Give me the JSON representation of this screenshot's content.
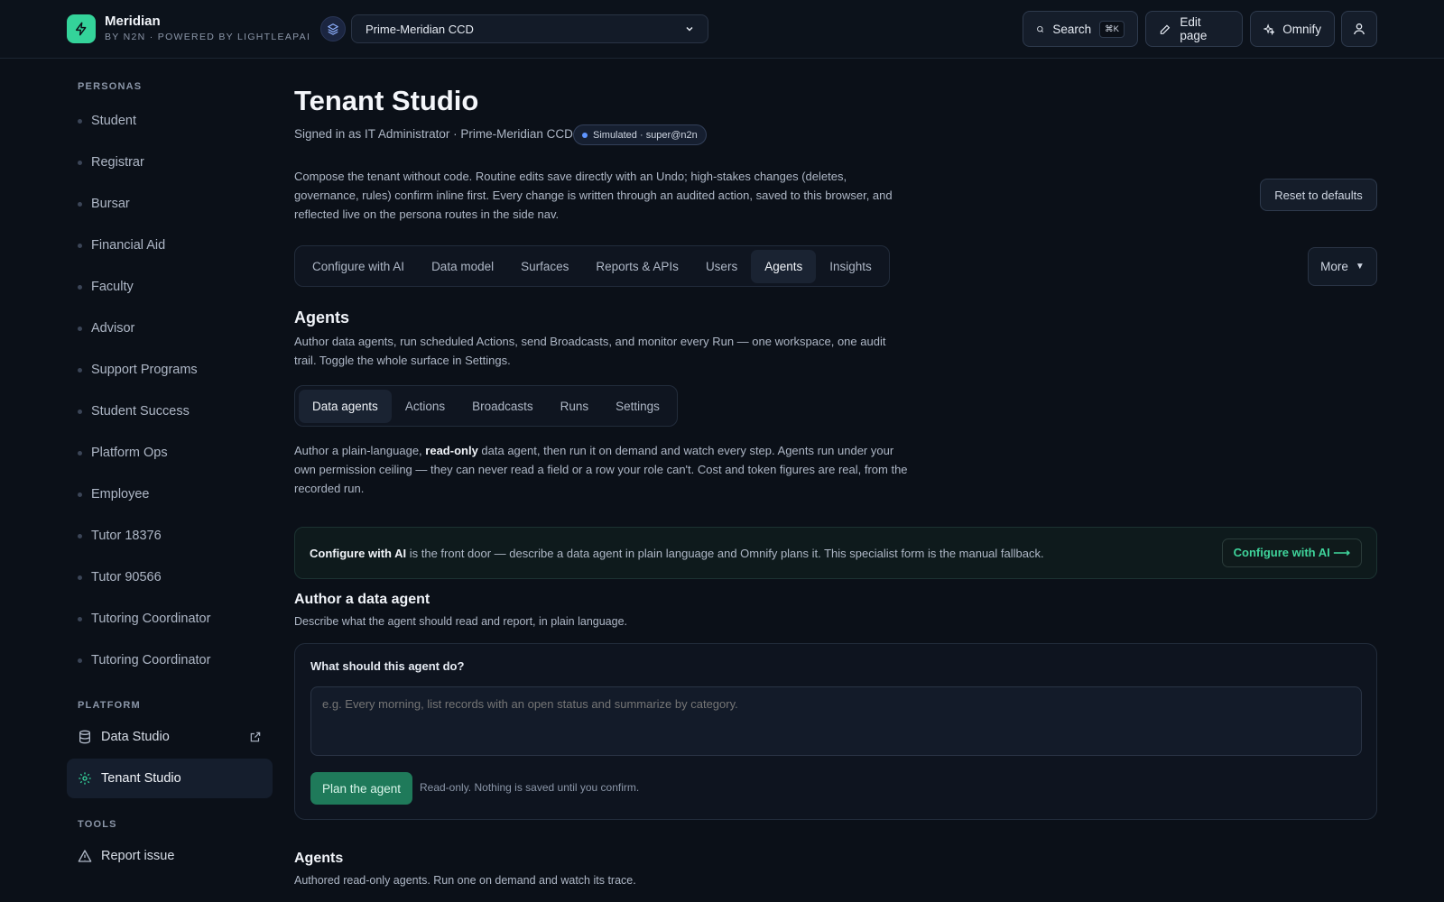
{
  "colors": {
    "accent": "#34d39a",
    "background": "#0b1018",
    "primary_button": "#1f7a5a",
    "link": "#3fd49b",
    "badge_dot": "#5f95ff"
  },
  "brand": {
    "name": "Meridian",
    "subtitle": "BY N2N · POWERED BY LIGHTLEAPAI",
    "logo_icon": "bolt-icon"
  },
  "tenant": {
    "selected": "Prime-Meridian CCD",
    "icon": "layers-icon"
  },
  "toolbar": {
    "search_label": "Search",
    "search_shortcut": "⌘K",
    "edit_label": "Edit page",
    "omnify_label": "Omnify",
    "profile_icon": "user-icon"
  },
  "sidebar": {
    "personas_label": "PERSONAS",
    "personas": [
      "Student",
      "Registrar",
      "Bursar",
      "Financial Aid",
      "Faculty",
      "Advisor",
      "Support Programs",
      "Student Success",
      "Platform Ops",
      "Employee",
      "Tutor 18376",
      "Tutor 90566",
      "Tutoring Coordinator",
      "Tutoring Coordinator"
    ],
    "platform_label": "PLATFORM",
    "platform": [
      {
        "label": "Data Studio",
        "icon": "database-icon",
        "external": true
      },
      {
        "label": "Tenant Studio",
        "icon": "gear-icon",
        "active": true
      }
    ],
    "tools_label": "TOOLS",
    "tools": [
      {
        "label": "Report issue",
        "icon": "warning-icon"
      }
    ]
  },
  "main": {
    "title": "Tenant Studio",
    "signed_in": "Signed in as IT Administrator · Prime-Meridian CCD",
    "badge": "Simulated · super@n2n",
    "intro": "Compose the tenant without code. Routine edits save directly with an Undo; high-stakes changes (deletes, governance, rules) confirm inline first. Every change is written through an audited action, saved to this browser, and reflected live on the persona routes in the side nav.",
    "reset_label": "Reset to defaults",
    "tabs": [
      "Configure with AI",
      "Data model",
      "Surfaces",
      "Reports & APIs",
      "Users",
      "Agents",
      "Insights"
    ],
    "active_tab": "Agents",
    "more_label": "More",
    "agents": {
      "heading": "Agents",
      "description": "Author data agents, run scheduled Actions, send Broadcasts, and monitor every Run — one workspace, one audit trail. Toggle the whole surface in Settings.",
      "subtabs": [
        "Data agents",
        "Actions",
        "Broadcasts",
        "Runs",
        "Settings"
      ],
      "active_subtab": "Data agents",
      "info_pre": "Author a plain-language, ",
      "info_bold": "read-only",
      "info_post": " data agent, then run it on demand and watch every step. Agents run under your own permission ceiling — they can never read a field or a row your role can't. Cost and token figures are real, from the recorded run.",
      "banner_bold": "Configure with AI",
      "banner_text": " is the front door — describe a data agent in plain language and Omnify plans it. This specialist form is the manual fallback.",
      "banner_cta": "Configure with AI ⟶",
      "author_heading": "Author a data agent",
      "author_sub": "Describe what the agent should read and report, in plain language.",
      "form_label": "What should this agent do?",
      "form_placeholder": "e.g. Every morning, list records with an open status and summarize by category.",
      "plan_label": "Plan the agent",
      "plan_note": "Read-only. Nothing is saved until you confirm.",
      "list_heading": "Agents",
      "list_sub": "Authored read-only agents. Run one on demand and watch its trace."
    }
  }
}
